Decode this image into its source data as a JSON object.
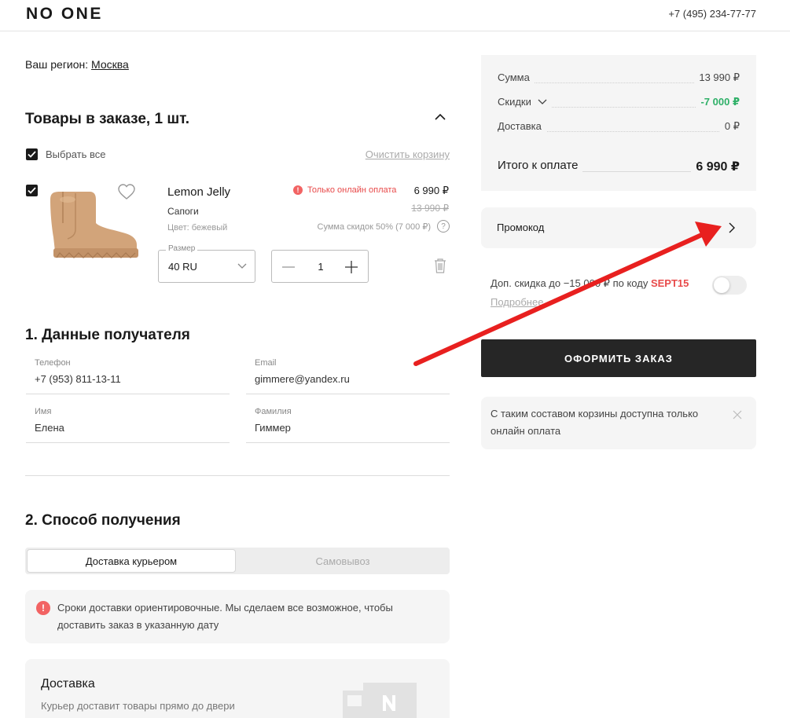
{
  "header": {
    "logo": "NO ONE",
    "phone": "+7 (495) 234-77-77"
  },
  "region": {
    "label": "Ваш регион:",
    "city": "Москва"
  },
  "cart": {
    "title": "Товары в заказе, 1 шт.",
    "select_all": "Выбрать все",
    "clear_cart": "Очистить корзину",
    "item": {
      "name": "Lemon Jelly",
      "type": "Сапоги",
      "color": "Цвет: бежевый",
      "online_only": "Только онлайн оплата",
      "price": "6 990 ₽",
      "old_price": "13 990 ₽",
      "discount_sum": "Сумма скидок 50% (7 000 ₽)",
      "help": "?",
      "size_label": "Размер",
      "size_value": "40 RU",
      "quantity": "1"
    }
  },
  "recipient": {
    "title": "1. Данные получателя",
    "phone_label": "Телефон",
    "phone_value": "+7 (953) 811-13-11",
    "email_label": "Email",
    "email_value": "gimmere@yandex.ru",
    "name_label": "Имя",
    "name_value": "Елена",
    "surname_label": "Фамилия",
    "surname_value": "Гиммер"
  },
  "delivery": {
    "title": "2. Способ получения",
    "tab_courier": "Доставка курьером",
    "tab_pickup": "Самовывоз",
    "notice_icon": "!",
    "notice": "Сроки доставки ориентировочные. Мы сделаем все возможное, чтобы доставить заказ в указанную дату",
    "card_title": "Доставка",
    "card_desc": "Курьер доставит товары прямо до двери"
  },
  "summary": {
    "sum_label": "Сумма",
    "sum_value": "13 990 ₽",
    "discount_label": "Скидки",
    "discount_value": "-7 000 ₽",
    "delivery_label": "Доставка",
    "delivery_value": "0 ₽",
    "total_label": "Итого к оплате",
    "total_value": "6 990 ₽"
  },
  "promo": {
    "label": "Промокод"
  },
  "extra_discount": {
    "text": "Доп. скидка до −15 000 ₽ по коду",
    "code": "SEPT15",
    "more": "Подробнее",
    "enabled": false
  },
  "order_button": "ОФОРМИТЬ ЗАКАЗ",
  "info": {
    "text": "С таким составом корзины доступна только онлайн оплата"
  },
  "colors": {
    "accent_red": "#e84a4a",
    "green": "#2fb068",
    "dark": "#262626",
    "annotation_arrow": "#e8201f"
  }
}
